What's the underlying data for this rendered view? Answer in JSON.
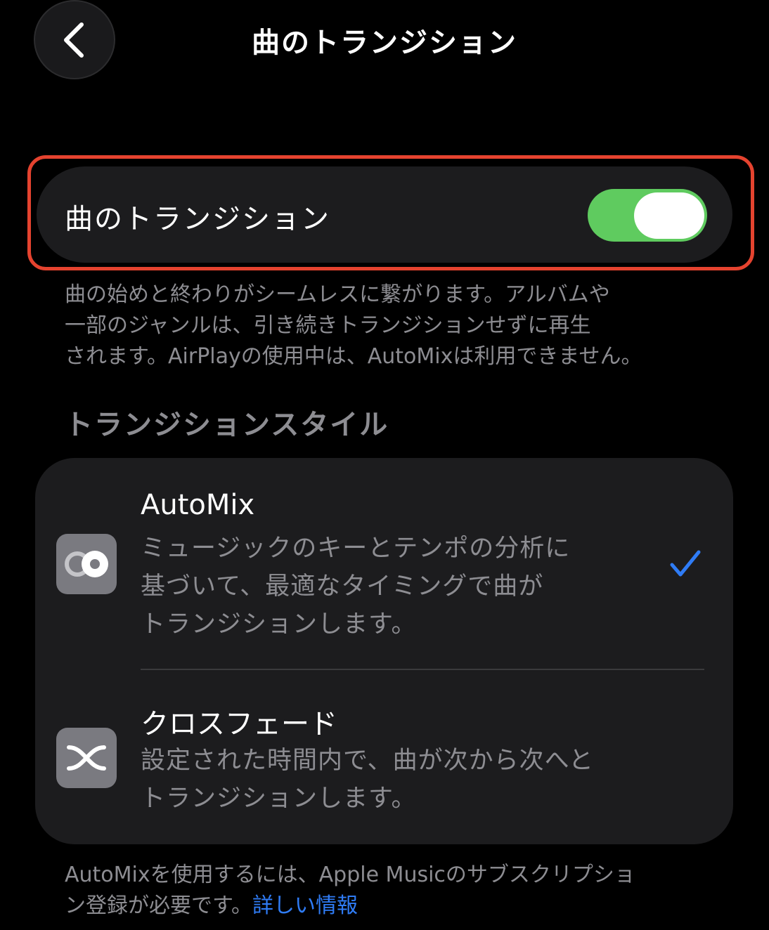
{
  "header": {
    "title": "曲のトランジション",
    "back_icon": "chevron-left-icon"
  },
  "toggle": {
    "label": "曲のトランジション",
    "on": true,
    "on_color": "#5fcb5f",
    "highlight_color": "#e5432f"
  },
  "toggle_description": {
    "line1": "曲の始めと終わりがシームレスに繋がります。アルバムや",
    "line2": "一部のジャンルは、引き続きトランジションせずに再生",
    "line3": "されます。AirPlayの使用中は、AutoMixは利用できません。"
  },
  "section": {
    "heading": "トランジションスタイル"
  },
  "options": [
    {
      "title": "AutoMix",
      "desc_line1": "ミュージックのキーとテンポの分析に",
      "desc_line2": "基づいて、最適なタイミングで曲が",
      "desc_line3": "トランジションします。",
      "icon": "automix-icon",
      "selected": true
    },
    {
      "title": "クロスフェード",
      "desc_line1": "設定された時間内で、曲が次から次へと",
      "desc_line2": "トランジションします。",
      "icon": "crossfade-icon",
      "selected": false
    }
  ],
  "footer": {
    "line1": "AutoMixを使用するには、Apple Musicのサブスクリプショ",
    "line2": "ン登録が必要です。",
    "link": "詳しい情報",
    "link_color": "#2f7cf6"
  }
}
